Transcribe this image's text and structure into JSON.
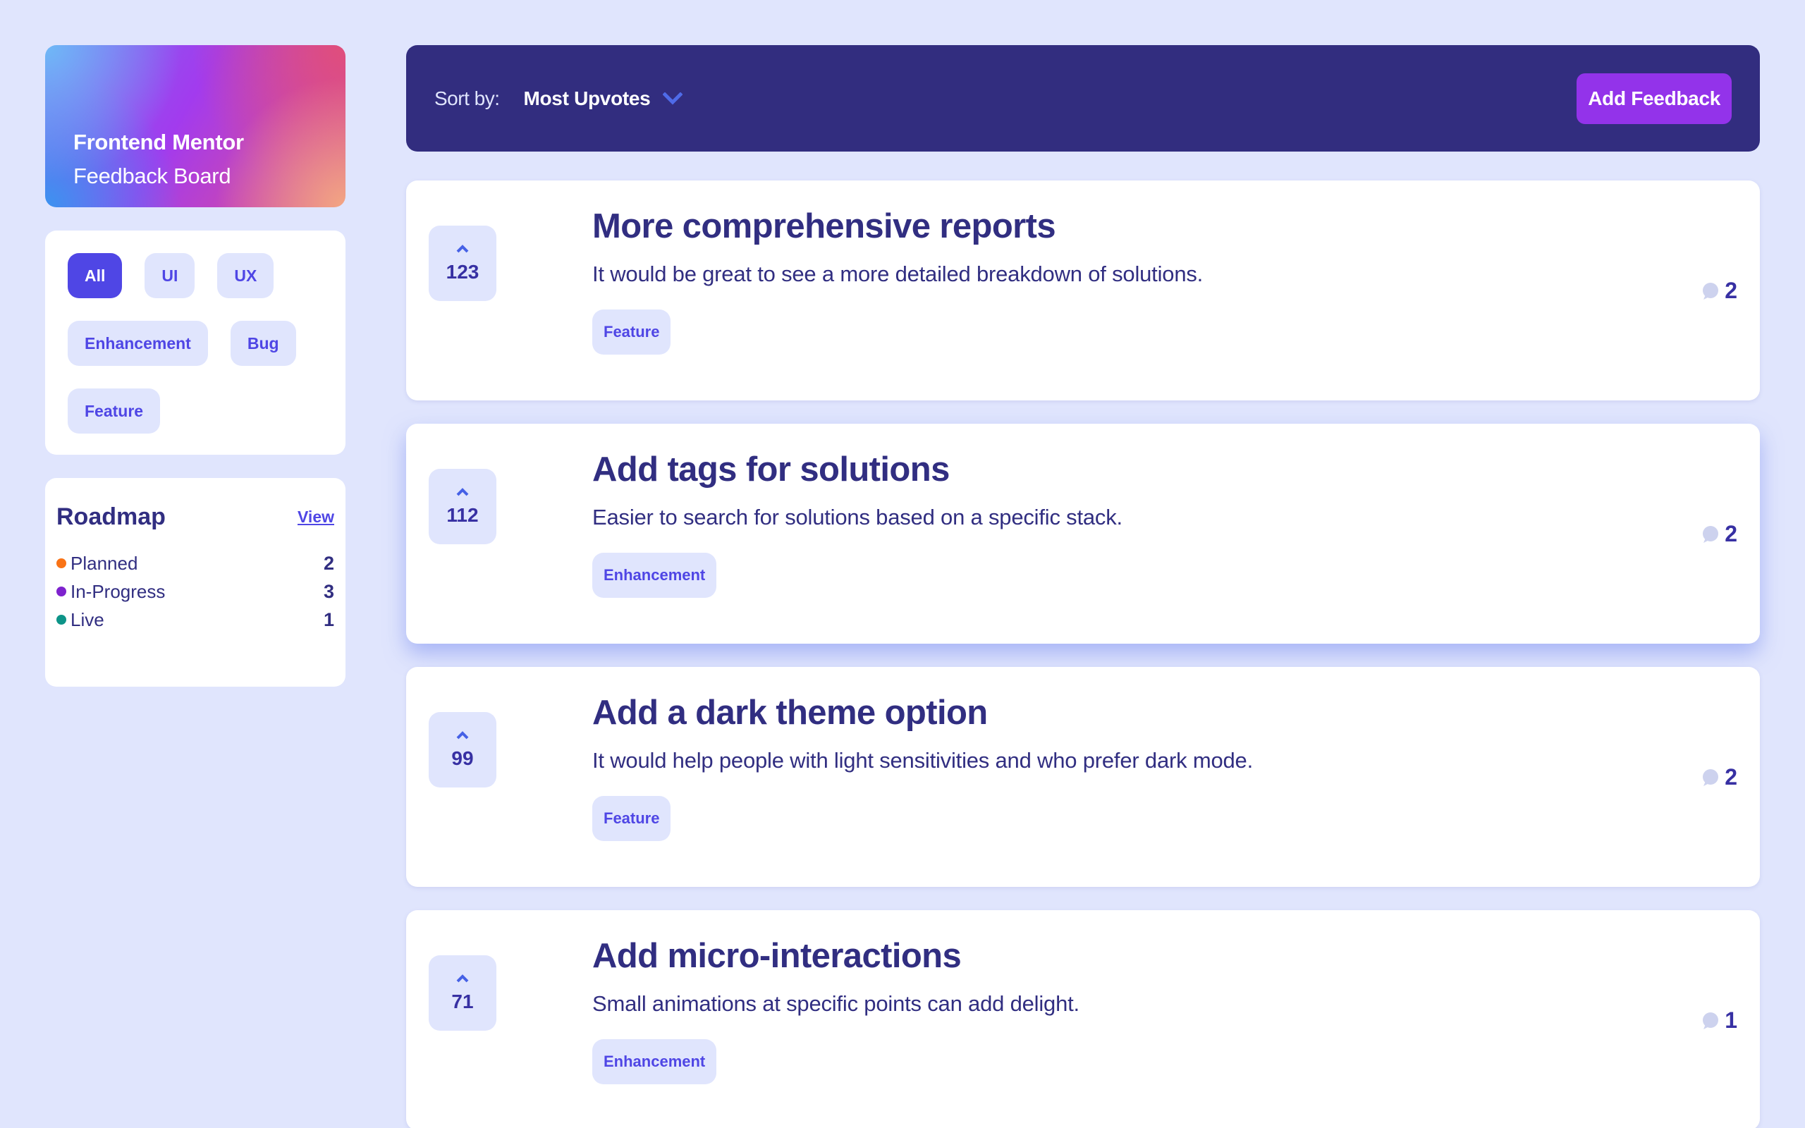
{
  "brand": {
    "title": "Frontend Mentor",
    "subtitle": "Feedback Board"
  },
  "filters": {
    "items": [
      {
        "label": "All",
        "active": true
      },
      {
        "label": "UI",
        "active": false
      },
      {
        "label": "UX",
        "active": false
      },
      {
        "label": "Enhancement",
        "active": false
      },
      {
        "label": "Bug",
        "active": false
      },
      {
        "label": "Feature",
        "active": false
      }
    ]
  },
  "roadmap": {
    "title": "Roadmap",
    "view_label": "View",
    "items": [
      {
        "label": "Planned",
        "count": "2",
        "color": "#F97316"
      },
      {
        "label": "In-Progress",
        "count": "3",
        "color": "#7E22CE"
      },
      {
        "label": "Live",
        "count": "1",
        "color": "#0D9488"
      }
    ]
  },
  "toolbar": {
    "sort_label": "Sort by:",
    "sort_value": "Most Upvotes",
    "add_label": "Add Feedback"
  },
  "colors": {
    "background": "#E0E5FD",
    "topbar": "#322D7F",
    "accent": "#4F46E5",
    "add_button": "#9333EA",
    "chevron": "#4F6BE8",
    "bubble": "#CDD2EE"
  },
  "feedback": [
    {
      "upvotes": "123",
      "title": "More comprehensive reports",
      "description": "It would be great to see a more detailed breakdown of solutions.",
      "tag": "Feature",
      "comments": "2"
    },
    {
      "upvotes": "112",
      "title": "Add tags for solutions",
      "description": "Easier to search for solutions based on a specific stack.",
      "tag": "Enhancement",
      "comments": "2"
    },
    {
      "upvotes": "99",
      "title": "Add a dark theme option",
      "description": "It would help people with light sensitivities and who prefer dark mode.",
      "tag": "Feature",
      "comments": "2"
    },
    {
      "upvotes": "71",
      "title": "Add micro-interactions",
      "description": "Small animations at specific points can add delight.",
      "tag": "Enhancement",
      "comments": "1"
    }
  ]
}
